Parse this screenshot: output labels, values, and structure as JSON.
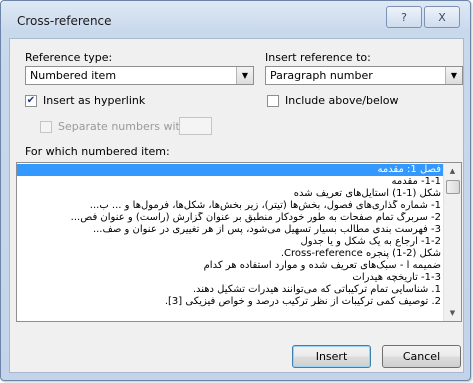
{
  "window": {
    "title": "Cross-reference",
    "help_glyph": "?",
    "close_glyph": "X"
  },
  "reference_type": {
    "label": "Reference type:",
    "value": "Numbered item"
  },
  "insert_reference_to": {
    "label": "Insert reference to:",
    "value": "Paragraph number"
  },
  "options": {
    "insert_as_hyperlink": {
      "label": "Insert as hyperlink",
      "checked": true
    },
    "include_above_below": {
      "label": "Include above/below",
      "checked": false
    },
    "separate_numbers_with": {
      "label": "Separate numbers with",
      "checked": false,
      "enabled": false,
      "value": ""
    }
  },
  "list": {
    "label": "For which numbered item:",
    "items": [
      "فصل 1: مقدمه",
      "1-1- مقدمه",
      "شکل (1-1) استایل‌های تعریف شده",
      "1- شماره گذاری‌های فصول، بخش‌ها (تیتر)، زیر بخش‌ها، شکل‌ها، فرمول‌ها و ... ب...",
      "2- سربرگ تمام صفحات به طور خودکار منطبق بر عنوان گزارش (راست) و عنوان فص...",
      "3- فهرست بندی مطالب بسیار تسهیل می‌شود، پس از هر تغییری در عنوان و صف...",
      "1-2- ارجاع به یک شکل و یا جدول",
      "شکل (2-1) پنجره Cross-reference.",
      "ضمیمه أ - سبک‌های تعریف شده و موارد استفاده هر کدام",
      "1-3- تاریخچه هیدرات",
      "1. شناسایی تمام ترکیباتی که می‌توانند هیدرات تشکیل دهند.",
      "2. توصیف کمی ترکیبات از نظر ترکیب درصد و خواص فیزیکی [3]."
    ],
    "selected_index": 0
  },
  "buttons": {
    "insert": "Insert",
    "cancel": "Cancel"
  },
  "icons": {
    "dropdown": "chevron-down-icon",
    "check": "check-icon",
    "scroll_up": "scroll-up-arrow-icon",
    "scroll_down": "scroll-down-arrow-icon"
  }
}
